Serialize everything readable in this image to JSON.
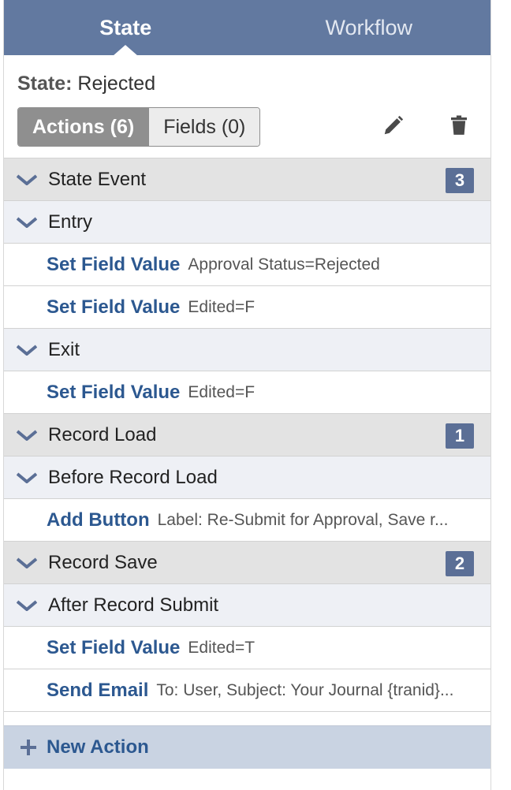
{
  "header": {
    "tabs": [
      {
        "label": "State"
      },
      {
        "label": "Workflow"
      }
    ]
  },
  "state": {
    "label": "State:",
    "value": "Rejected"
  },
  "toolbar": {
    "actions_tab": "Actions (6)",
    "fields_tab": "Fields (0)",
    "edit_icon": "pencil-icon",
    "delete_icon": "trash-icon"
  },
  "events": {
    "state_event": {
      "label": "State Event",
      "count": "3"
    },
    "entry": {
      "label": "Entry"
    },
    "entry_actions": [
      {
        "name": "Set Field Value",
        "desc": "Approval Status=Rejected"
      },
      {
        "name": "Set Field Value",
        "desc": "Edited=F"
      }
    ],
    "exit": {
      "label": "Exit"
    },
    "exit_actions": [
      {
        "name": "Set Field Value",
        "desc": "Edited=F"
      }
    ],
    "record_load": {
      "label": "Record Load",
      "count": "1"
    },
    "before_record_load": {
      "label": "Before Record Load"
    },
    "before_load_actions": [
      {
        "name": "Add Button",
        "desc": "Label: Re-Submit for Approval, Save r..."
      }
    ],
    "record_save": {
      "label": "Record Save",
      "count": "2"
    },
    "after_record_submit": {
      "label": "After Record Submit"
    },
    "after_submit_actions": [
      {
        "name": "Set Field Value",
        "desc": "Edited=T"
      },
      {
        "name": "Send Email",
        "desc": "To: User, Subject: Your Journal {tranid}..."
      }
    ]
  },
  "footer": {
    "new_action": "New Action"
  },
  "colors": {
    "header": "#6279a0",
    "badge": "#5b6f96",
    "link": "#2c5890",
    "footer": "#c9d3e2"
  }
}
